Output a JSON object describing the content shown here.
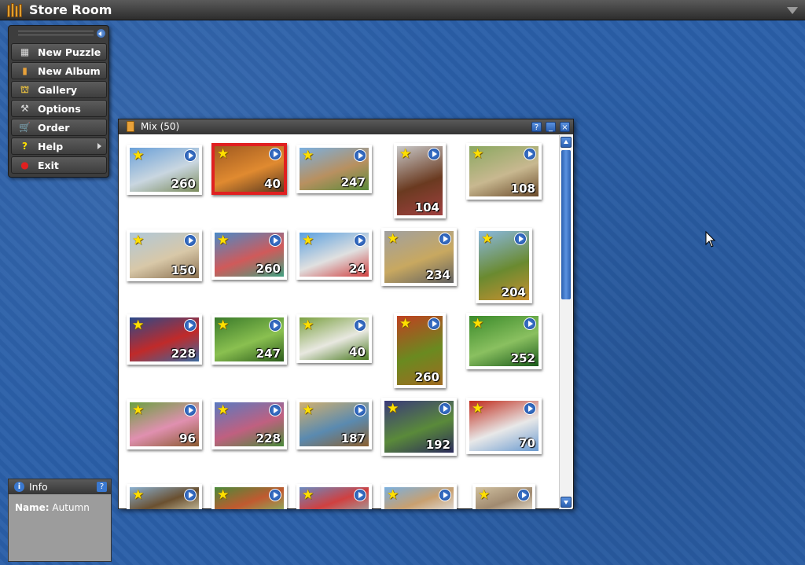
{
  "app": {
    "title": "Store Room"
  },
  "menu": {
    "items": [
      {
        "label": "New Puzzle",
        "icon": "puzzle-icon",
        "glyph": "▦"
      },
      {
        "label": "New Album",
        "icon": "album-icon",
        "glyph": "▮"
      },
      {
        "label": "Gallery",
        "icon": "gallery-icon",
        "glyph": "⛫"
      },
      {
        "label": "Options",
        "icon": "wrench-icon",
        "glyph": "⚒"
      },
      {
        "label": "Order",
        "icon": "cart-icon",
        "glyph": "🛒"
      },
      {
        "label": "Help",
        "icon": "help-icon",
        "glyph": "?"
      },
      {
        "label": "Exit",
        "icon": "exit-icon",
        "glyph": "●"
      }
    ]
  },
  "info": {
    "title": "Info",
    "name_label": "Name:",
    "name_value": "Autumn",
    "help": "?"
  },
  "album": {
    "title": "Mix (50)",
    "help": "?",
    "minimize": "_",
    "close": "×"
  },
  "tiles": [
    {
      "count": "260",
      "colors": [
        "#6aa0d8",
        "#c9d6e0",
        "#7a8a5a"
      ]
    },
    {
      "count": "40",
      "colors": [
        "#a05a20",
        "#e08a30",
        "#5a3a20"
      ],
      "selected": true
    },
    {
      "count": "247",
      "colors": [
        "#7ab0e0",
        "#b89060",
        "#5a8a3a"
      ]
    },
    {
      "count": "104",
      "colors": [
        "#c8c8c8",
        "#6a3a20",
        "#a04040"
      ]
    },
    {
      "count": "108",
      "colors": [
        "#8aa860",
        "#c8b890",
        "#6a4a2a"
      ]
    },
    {
      "count": "150",
      "colors": [
        "#b0c8d8",
        "#d8c8a8",
        "#8a7050"
      ]
    },
    {
      "count": "260",
      "colors": [
        "#4a8ac8",
        "#d05a5a",
        "#40a080"
      ]
    },
    {
      "count": "24",
      "colors": [
        "#5aa0e0",
        "#e0e0e0",
        "#d04040"
      ]
    },
    {
      "count": "234",
      "colors": [
        "#a0a0a0",
        "#c8a860",
        "#606060"
      ]
    },
    {
      "count": "204",
      "colors": [
        "#8ab8e0",
        "#6a8a30",
        "#c89030"
      ]
    },
    {
      "count": "228",
      "colors": [
        "#2a4a8a",
        "#c02a2a",
        "#3a6aa0"
      ]
    },
    {
      "count": "247",
      "colors": [
        "#3a7a2a",
        "#8ac050",
        "#2a5a1a"
      ]
    },
    {
      "count": "40",
      "colors": [
        "#7aa040",
        "#e8e8e0",
        "#4a7a20"
      ]
    },
    {
      "count": "260",
      "colors": [
        "#c04020",
        "#6a8a20",
        "#a06a20"
      ]
    },
    {
      "count": "252",
      "colors": [
        "#3a8a2a",
        "#8ac060",
        "#1a5a1a"
      ]
    },
    {
      "count": "96",
      "colors": [
        "#6aa040",
        "#e090b0",
        "#8a5a30"
      ]
    },
    {
      "count": "228",
      "colors": [
        "#5a7ac0",
        "#c06080",
        "#4a8a3a"
      ]
    },
    {
      "count": "187",
      "colors": [
        "#d0b070",
        "#5a8ab0",
        "#8a6030"
      ]
    },
    {
      "count": "192",
      "colors": [
        "#3a3a7a",
        "#5a8a3a",
        "#2a2a5a"
      ]
    },
    {
      "count": "70",
      "colors": [
        "#c02a1a",
        "#e8e8e8",
        "#6a9ad0"
      ]
    },
    {
      "count": "",
      "colors": [
        "#8ab0d0",
        "#6a5030",
        "#c8c0a0"
      ]
    },
    {
      "count": "",
      "colors": [
        "#4a8a3a",
        "#c05a30",
        "#8ab060"
      ]
    },
    {
      "count": "",
      "colors": [
        "#6a8ac0",
        "#d04040",
        "#a0a0a0"
      ]
    },
    {
      "count": "",
      "colors": [
        "#7ab0e0",
        "#c8a070",
        "#e0e0e0"
      ]
    },
    {
      "count": "",
      "colors": [
        "#d0c0a0",
        "#a08a70",
        "#e8e0d0"
      ]
    }
  ]
}
